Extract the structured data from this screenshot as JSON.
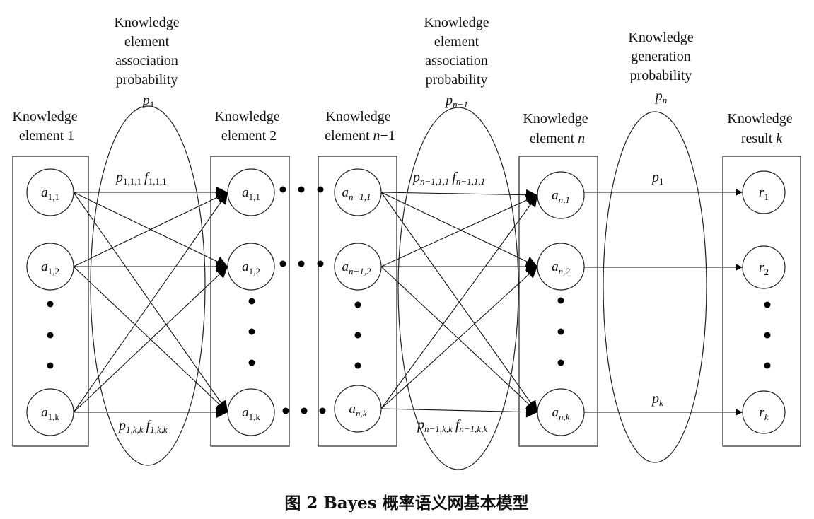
{
  "columns": {
    "col1": {
      "title_lines": [
        "Knowledge",
        "element 1"
      ],
      "nodes": [
        {
          "base": "a",
          "sub": "1,1"
        },
        {
          "base": "a",
          "sub": "1,2"
        },
        {
          "base": "a",
          "sub": "1,k"
        }
      ]
    },
    "col2": {
      "title_lines": [
        "Knowledge",
        "element 2"
      ],
      "nodes": [
        {
          "base": "a",
          "sub": "1,1"
        },
        {
          "base": "a",
          "sub": "1,2"
        },
        {
          "base": "a",
          "sub": "1,k"
        }
      ]
    },
    "col3": {
      "title_line1": "Knowledge",
      "title_line2_prefix": "element ",
      "title_line2_var": "n",
      "title_line2_suffix": "−1",
      "nodes": [
        {
          "base": "a",
          "sub": "n−1,1"
        },
        {
          "base": "a",
          "sub": "n−1,2"
        },
        {
          "base": "a",
          "sub": "n,k"
        }
      ]
    },
    "col4": {
      "title_line1": "Knowledge",
      "title_line2_prefix": "element ",
      "title_line2_var": "n",
      "nodes": [
        {
          "base": "a",
          "sub": "n,1"
        },
        {
          "base": "a",
          "sub": "n,2"
        },
        {
          "base": "a",
          "sub": "n,k"
        }
      ]
    },
    "col5": {
      "title_line1": "Knowledge",
      "title_line2_prefix": "result ",
      "title_line2_var": "k",
      "nodes": [
        {
          "base": "r",
          "sub": "1"
        },
        {
          "base": "r",
          "sub": "2"
        },
        {
          "base": "r",
          "sub": "k"
        }
      ]
    }
  },
  "ellipses": {
    "e1": {
      "lines": [
        "Knowledge",
        "element",
        "association",
        "probability"
      ],
      "p_base": "p",
      "p_sub": "1",
      "top_label": {
        "p": "p",
        "p_sub": "1,1,1",
        "f": "f",
        "f_sub": "1,1,1"
      },
      "bottom_label": {
        "p": "p",
        "p_sub": "1,k,k",
        "f": "f",
        "f_sub": "1,k,k"
      }
    },
    "e2": {
      "lines": [
        "Knowledge",
        "element",
        "association",
        "probability"
      ],
      "p_base": "p",
      "p_sub": "n−1",
      "top_label": {
        "p": "p",
        "p_sub": "n−1,1,1",
        "f": "f",
        "f_sub": "n−1,1,1"
      },
      "bottom_label": {
        "p": "p",
        "p_sub": "n−1,k,k",
        "f": "f",
        "f_sub": "n−1,k,k"
      }
    },
    "e3": {
      "lines": [
        "Knowledge",
        "generation",
        "probability"
      ],
      "p_base": "p",
      "p_sub": "n",
      "top_label": {
        "p": "p",
        "p_sub": "1"
      },
      "bottom_label": {
        "p": "p",
        "p_sub": "k"
      }
    }
  },
  "caption": "图 2   Bayes 概率语义网基本模型"
}
